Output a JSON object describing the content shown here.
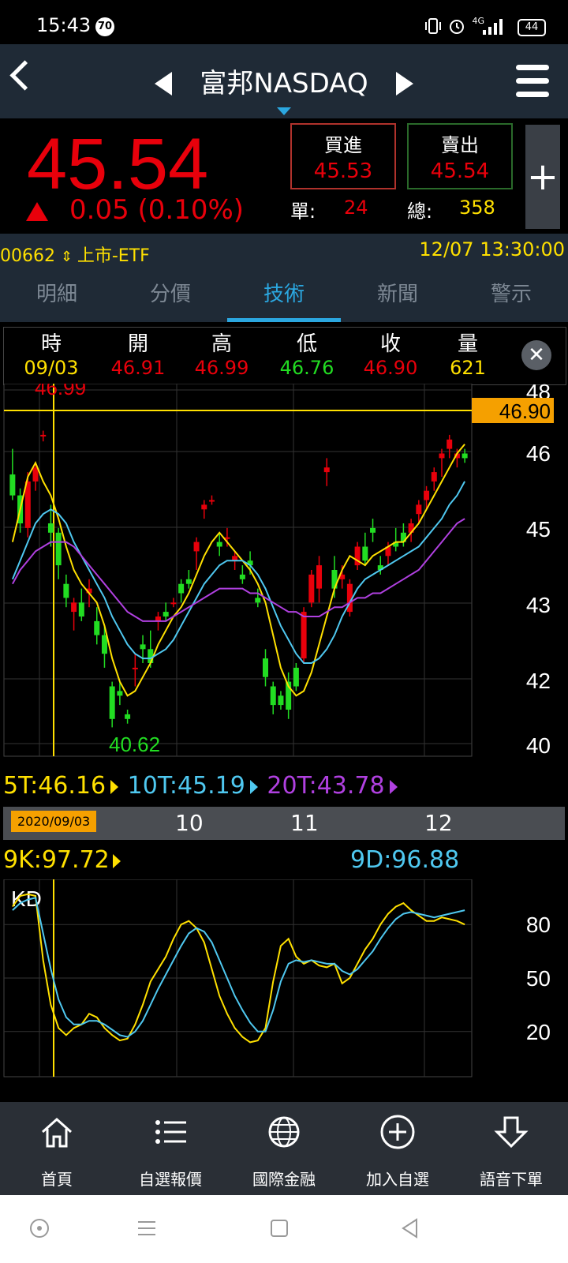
{
  "status_bar": {
    "time": "15:43",
    "badge": "70",
    "network": "4G",
    "battery": "44"
  },
  "header": {
    "title": "富邦NASDAQ"
  },
  "quote": {
    "price": "45.54",
    "change": "0.05 (0.10%)",
    "buy_label": "買進",
    "buy_value": "45.53",
    "sell_label": "賣出",
    "sell_value": "45.54",
    "unit_label": "單:",
    "unit_value": "24",
    "total_label": "總:",
    "total_value": "358",
    "plus": "+"
  },
  "code_bar": {
    "code": "00662",
    "market": "上市-ETF",
    "datetime": "12/07 13:30:00"
  },
  "tabs": [
    "明細",
    "分價",
    "技術",
    "新聞",
    "警示"
  ],
  "active_tab": "技術",
  "ohlc": {
    "headers": [
      "時",
      "開",
      "高",
      "低",
      "收",
      "量"
    ],
    "values": [
      "09/03",
      "46.91",
      "46.99",
      "46.76",
      "46.90",
      "621"
    ]
  },
  "price_chart": {
    "y_ticks": [
      "48",
      "46",
      "45",
      "43",
      "42",
      "40"
    ],
    "current_price_label": "46.90",
    "high_marker": "46.99",
    "low_marker": "40.62"
  },
  "ma_legend": {
    "ma5": "5T:46.16",
    "ma10": "10T:45.19",
    "ma20": "20T:43.78"
  },
  "date_axis": {
    "cursor_date": "2020/09/03",
    "months": [
      "10",
      "11",
      "12"
    ]
  },
  "kd_legend": {
    "k": "9K:97.72",
    "d": "9D:96.88",
    "panel_label": "KD"
  },
  "kd_chart": {
    "y_ticks": [
      "80",
      "50",
      "20"
    ]
  },
  "bottom_nav": [
    "首頁",
    "自選報價",
    "國際金融",
    "加入自選",
    "語音下單"
  ],
  "colors": {
    "up": "#e8000b",
    "down": "#22dd22",
    "ma5": "#ffe000",
    "ma10": "#4fc8f0",
    "ma20": "#b040e0",
    "panel": "#1f2a36"
  },
  "chart_data": [
    {
      "type": "candlestick",
      "title": "",
      "x_labels": [
        "2020/09/03",
        "10",
        "11",
        "12"
      ],
      "ylim": [
        40,
        48
      ],
      "candles": [
        [
          46.05,
          46.6,
          45.5,
          45.6
        ],
        [
          45.6,
          45.75,
          44.8,
          45.0
        ],
        [
          44.9,
          46.1,
          44.7,
          45.9
        ],
        [
          45.9,
          46.3,
          45.7,
          46.2
        ],
        [
          46.9,
          46.99,
          46.76,
          46.9
        ],
        [
          45.0,
          45.4,
          44.5,
          44.8
        ],
        [
          44.8,
          44.9,
          43.8,
          44.1
        ],
        [
          43.7,
          43.9,
          43.2,
          43.4
        ],
        [
          43.1,
          43.4,
          42.7,
          43.3
        ],
        [
          43.3,
          43.6,
          42.9,
          43.0
        ],
        [
          43.5,
          43.8,
          43.2,
          43.6
        ],
        [
          42.9,
          43.2,
          42.4,
          42.6
        ],
        [
          42.6,
          42.8,
          41.9,
          42.2
        ],
        [
          41.5,
          41.6,
          40.62,
          40.8
        ],
        [
          41.4,
          41.6,
          41.1,
          41.3
        ],
        [
          40.9,
          41.0,
          40.7,
          40.8
        ],
        [
          41.9,
          42.2,
          41.5,
          41.9
        ],
        [
          42.4,
          42.6,
          42.0,
          42.3
        ],
        [
          42.3,
          42.7,
          41.9,
          42.0
        ],
        [
          42.9,
          43.1,
          42.7,
          43.0
        ],
        [
          43.1,
          43.3,
          42.9,
          43.0
        ],
        [
          43.3,
          43.4,
          43.2,
          43.3
        ],
        [
          43.7,
          43.8,
          43.3,
          43.5
        ],
        [
          43.8,
          44.0,
          43.6,
          43.7
        ],
        [
          44.4,
          44.7,
          44.0,
          44.6
        ],
        [
          45.3,
          45.5,
          45.1,
          45.4
        ],
        [
          45.5,
          45.6,
          45.4,
          45.5
        ],
        [
          44.6,
          44.8,
          44.3,
          44.5
        ],
        [
          44.7,
          44.9,
          44.5,
          44.7
        ],
        [
          44.2,
          44.4,
          44.0,
          44.3
        ],
        [
          43.9,
          44.1,
          43.7,
          43.8
        ],
        [
          44.2,
          44.4,
          43.9,
          44.1
        ],
        [
          43.4,
          43.6,
          43.2,
          43.3
        ],
        [
          42.1,
          42.3,
          41.5,
          41.7
        ],
        [
          41.5,
          41.6,
          40.9,
          41.1
        ],
        [
          41.3,
          41.4,
          41.0,
          41.1
        ],
        [
          41.6,
          41.8,
          40.8,
          41.0
        ],
        [
          41.9,
          42.0,
          41.4,
          41.5
        ],
        [
          42.1,
          43.2,
          42.0,
          43.1
        ],
        [
          43.3,
          44.0,
          43.2,
          43.9
        ],
        [
          43.6,
          44.3,
          43.3,
          44.1
        ],
        [
          46.1,
          46.4,
          45.8,
          46.2
        ],
        [
          44.0,
          44.3,
          43.4,
          43.6
        ],
        [
          43.8,
          44.1,
          43.6,
          43.9
        ],
        [
          43.1,
          43.8,
          43.0,
          43.7
        ],
        [
          44.1,
          44.6,
          44.0,
          44.5
        ],
        [
          44.5,
          44.8,
          44.1,
          44.2
        ],
        [
          44.9,
          45.1,
          44.6,
          44.8
        ],
        [
          44.1,
          44.3,
          43.9,
          44.0
        ],
        [
          44.3,
          44.6,
          44.1,
          44.5
        ],
        [
          44.6,
          44.9,
          44.4,
          44.5
        ],
        [
          44.8,
          45.0,
          44.5,
          44.6
        ],
        [
          44.8,
          45.1,
          44.6,
          45.0
        ],
        [
          45.2,
          45.5,
          45.0,
          45.4
        ],
        [
          45.5,
          45.8,
          45.3,
          45.7
        ],
        [
          45.9,
          46.2,
          45.7,
          46.1
        ],
        [
          46.4,
          46.6,
          46.0,
          46.5
        ],
        [
          46.6,
          46.9,
          46.4,
          46.8
        ],
        [
          46.4,
          46.6,
          46.2,
          46.5
        ],
        [
          46.5,
          46.6,
          46.3,
          46.4
        ]
      ],
      "series": [
        {
          "name": "5T",
          "values": [
            44.6,
            45.3,
            46.0,
            46.3,
            45.9,
            45.6,
            45.1,
            44.5,
            44.0,
            43.7,
            43.5,
            43.3,
            42.8,
            42.1,
            41.6,
            41.3,
            41.4,
            41.7,
            42.0,
            42.4,
            42.7,
            43.0,
            43.2,
            43.5,
            43.9,
            44.3,
            44.6,
            44.8,
            44.6,
            44.4,
            44.2,
            44.0,
            43.7,
            43.3,
            42.6,
            41.9,
            41.5,
            41.3,
            41.4,
            41.8,
            42.4,
            43.0,
            43.6,
            44.0,
            44.3,
            44.2,
            44.1,
            44.3,
            44.4,
            44.5,
            44.6,
            44.6,
            44.8,
            45.0,
            45.3,
            45.6,
            45.9,
            46.2,
            46.5,
            46.7
          ]
        },
        {
          "name": "10T",
          "values": [
            43.8,
            44.2,
            44.6,
            45.0,
            45.2,
            45.3,
            45.2,
            45.0,
            44.6,
            44.3,
            44.0,
            43.7,
            43.4,
            43.0,
            42.7,
            42.4,
            42.2,
            42.1,
            42.1,
            42.2,
            42.3,
            42.5,
            42.8,
            43.1,
            43.4,
            43.7,
            43.9,
            44.1,
            44.2,
            44.2,
            44.2,
            44.1,
            43.9,
            43.6,
            43.2,
            42.8,
            42.5,
            42.2,
            42.0,
            42.0,
            42.1,
            42.3,
            42.6,
            43.0,
            43.3,
            43.6,
            43.8,
            43.9,
            44.0,
            44.1,
            44.2,
            44.3,
            44.4,
            44.5,
            44.7,
            44.9,
            45.1,
            45.4,
            45.6,
            45.9
          ]
        },
        {
          "name": "20T",
          "values": [
            43.7,
            44.0,
            44.2,
            44.4,
            44.5,
            44.6,
            44.6,
            44.6,
            44.5,
            44.3,
            44.1,
            43.9,
            43.7,
            43.5,
            43.3,
            43.1,
            43.0,
            42.9,
            42.9,
            42.9,
            42.9,
            43.0,
            43.1,
            43.2,
            43.3,
            43.4,
            43.5,
            43.6,
            43.6,
            43.6,
            43.6,
            43.5,
            43.5,
            43.4,
            43.3,
            43.2,
            43.1,
            43.1,
            43.0,
            43.0,
            43.0,
            43.1,
            43.2,
            43.2,
            43.3,
            43.4,
            43.4,
            43.5,
            43.5,
            43.6,
            43.7,
            43.8,
            43.9,
            44.0,
            44.2,
            44.4,
            44.6,
            44.8,
            45.0,
            45.1
          ]
        }
      ]
    },
    {
      "type": "line",
      "title": "KD",
      "ylim": [
        0,
        100
      ],
      "y_ticks": [
        80,
        50,
        20
      ],
      "series": [
        {
          "name": "9K",
          "values": [
            90,
            96,
            97,
            96,
            60,
            35,
            22,
            18,
            22,
            24,
            30,
            28,
            22,
            18,
            15,
            16,
            24,
            35,
            48,
            55,
            62,
            72,
            80,
            82,
            78,
            70,
            55,
            40,
            30,
            22,
            17,
            14,
            15,
            22,
            48,
            68,
            72,
            62,
            58,
            60,
            57,
            56,
            58,
            47,
            50,
            58,
            66,
            72,
            80,
            86,
            90,
            92,
            88,
            85,
            82,
            82,
            84,
            83,
            82,
            80
          ]
        },
        {
          "name": "9D",
          "values": [
            88,
            92,
            94,
            95,
            75,
            55,
            38,
            28,
            24,
            24,
            26,
            26,
            24,
            21,
            18,
            17,
            20,
            26,
            35,
            44,
            52,
            60,
            68,
            75,
            78,
            76,
            70,
            60,
            50,
            40,
            32,
            25,
            20,
            20,
            32,
            48,
            58,
            60,
            59,
            60,
            59,
            58,
            58,
            54,
            52,
            55,
            60,
            65,
            72,
            78,
            83,
            86,
            87,
            86,
            85,
            84,
            85,
            86,
            87,
            88
          ]
        }
      ]
    }
  ]
}
